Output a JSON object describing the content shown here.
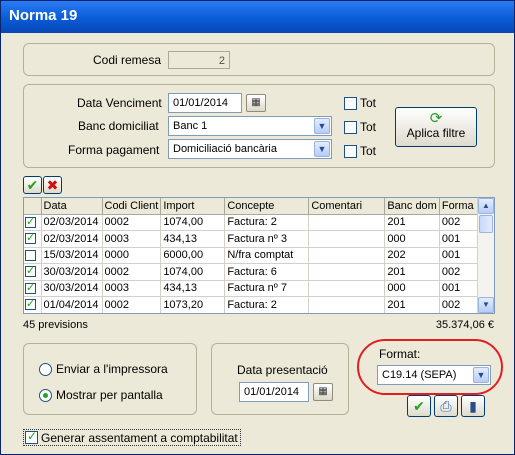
{
  "window": {
    "title": "Norma 19"
  },
  "remesa": {
    "label": "Codi remesa",
    "value": "2"
  },
  "filters": {
    "due_date_label": "Data Venciment",
    "due_date_value": "01/01/2014",
    "bank_label": "Banc domiciliat",
    "bank_value": "Banc 1",
    "payment_label": "Forma pagament",
    "payment_value": "Domiciliació bancària",
    "all_label": "Tot",
    "apply_label": "Aplica filtre"
  },
  "grid": {
    "columns": [
      "Data",
      "Codi Client",
      "Import",
      "Concepte",
      "Comentari",
      "Banc dom",
      "Forma pa"
    ],
    "rows": [
      {
        "checked": true,
        "cells": [
          "02/03/2014",
          "0002",
          "1074,00",
          "Factura: 2",
          "",
          "201",
          "002"
        ]
      },
      {
        "checked": true,
        "cells": [
          "02/03/2014",
          "0003",
          "434,13",
          "Factura nº 3",
          "",
          "000",
          "001"
        ]
      },
      {
        "checked": false,
        "cells": [
          "15/03/2014",
          "0000",
          "6000,00",
          "N/fra comptat",
          "",
          "202",
          "001"
        ]
      },
      {
        "checked": true,
        "cells": [
          "30/03/2014",
          "0002",
          "1074,00",
          "Factura: 6",
          "",
          "201",
          "002"
        ]
      },
      {
        "checked": true,
        "cells": [
          "30/03/2014",
          "0003",
          "434,13",
          "Factura nº 7",
          "",
          "000",
          "001"
        ]
      },
      {
        "checked": true,
        "cells": [
          "01/04/2014",
          "0002",
          "1073,20",
          "Factura: 2",
          "",
          "201",
          "002"
        ]
      }
    ],
    "count_text": "45 previsions",
    "total_text": "35.374,06 €"
  },
  "output": {
    "printer_label": "Enviar a l'impressora",
    "screen_label": "Mostrar per pantalla",
    "selected": "screen"
  },
  "presentation": {
    "label": "Data presentació",
    "value": "01/01/2014"
  },
  "format": {
    "label": "Format:",
    "value": "C19.14 (SEPA)"
  },
  "accounting": {
    "label": "Generar assentament a comptabilitat",
    "checked": true
  },
  "colors": {
    "titlebar": "#0a5bd6",
    "highlight": "#e02020",
    "accept": "#21a121"
  }
}
